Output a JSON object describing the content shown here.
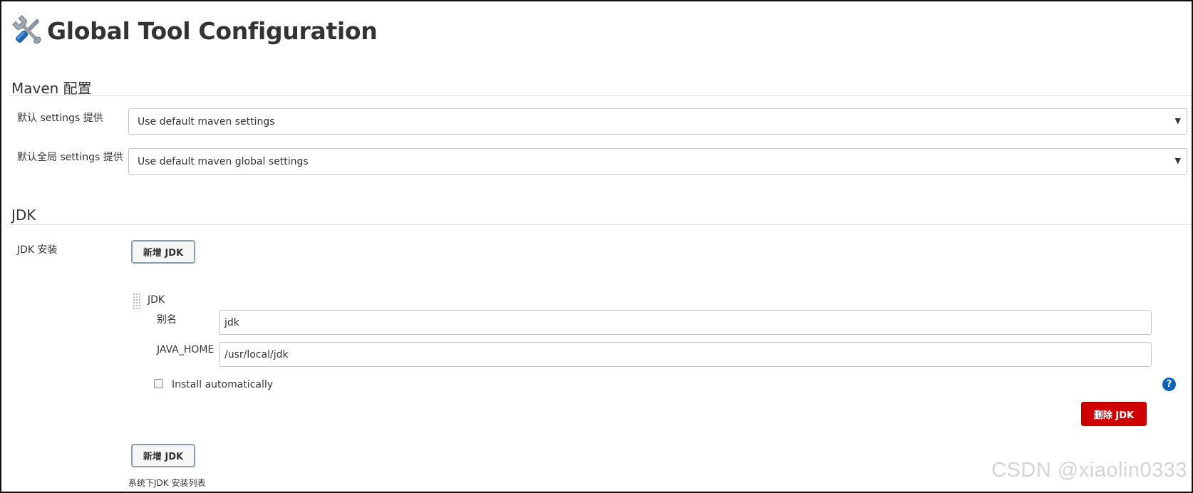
{
  "header": {
    "title": "Global Tool Configuration",
    "icon": "wrench-screwdriver-icon"
  },
  "maven": {
    "section_title": "Maven 配置",
    "settings_label": "默认 settings 提供",
    "settings_value": "Use default maven settings",
    "global_settings_label": "默认全局 settings 提供",
    "global_settings_value": "Use default maven global settings"
  },
  "jdk": {
    "section_title": "JDK",
    "install_label": "JDK 安装",
    "add_button_top": "新增 JDK",
    "item_title": "JDK",
    "alias_label": "别名",
    "alias_value": "jdk",
    "java_home_label": "JAVA_HOME",
    "java_home_value": "/usr/local/jdk",
    "install_auto_label": "Install automatically",
    "install_auto_checked": false,
    "help_glyph": "?",
    "delete_button": "删除 JDK",
    "add_button_bottom": "新增 JDK",
    "list_note": "系统下JDK 安装列表"
  },
  "watermark": "CSDN @xiaolin0333",
  "colors": {
    "danger": "#d10000",
    "help": "#0b62b6",
    "rule": "#dddddd"
  }
}
